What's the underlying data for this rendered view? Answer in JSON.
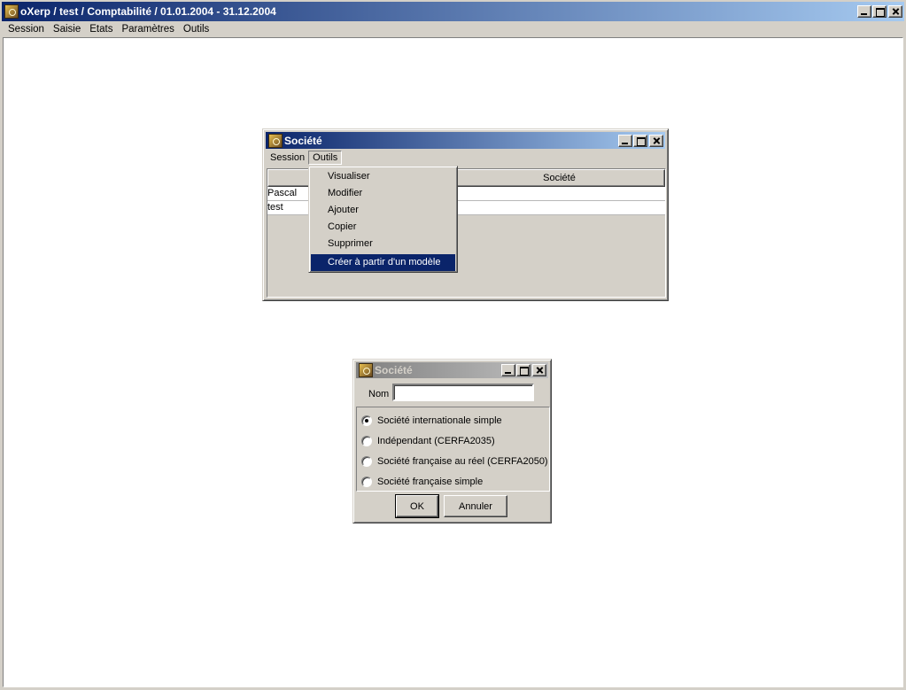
{
  "main_window": {
    "title": "oXerp / test / Comptabilité / 01.01.2004 - 31.12.2004",
    "menu": [
      "Session",
      "Saisie",
      "Etats",
      "Paramètres",
      "Outils"
    ]
  },
  "societe_window": {
    "title": "Société",
    "menu": [
      "Session",
      "Outils"
    ],
    "table": {
      "columns": [
        "",
        "Société"
      ],
      "rows": [
        [
          "Pascal",
          ""
        ],
        [
          "test",
          ""
        ]
      ]
    }
  },
  "outils_menu": {
    "items": [
      "Visualiser",
      "Modifier",
      "Ajouter",
      "Copier",
      "Supprimer",
      "Créer à partir d'un modèle"
    ],
    "selected_index": 5
  },
  "dialog": {
    "title": "Société",
    "nom_label": "Nom",
    "nom_value": "",
    "options": [
      "Société internationale simple",
      "Indépendant (CERFA2035)",
      "Société française au réel (CERFA2050)",
      "Société française simple"
    ],
    "selected_option": 0,
    "ok_label": "OK",
    "cancel_label": "Annuler"
  },
  "colors": {
    "title_active": "#0a246a",
    "title_active_end": "#a6caf0",
    "title_inactive": "#808080",
    "face": "#d4d0c8",
    "selection": "#0a246a"
  }
}
